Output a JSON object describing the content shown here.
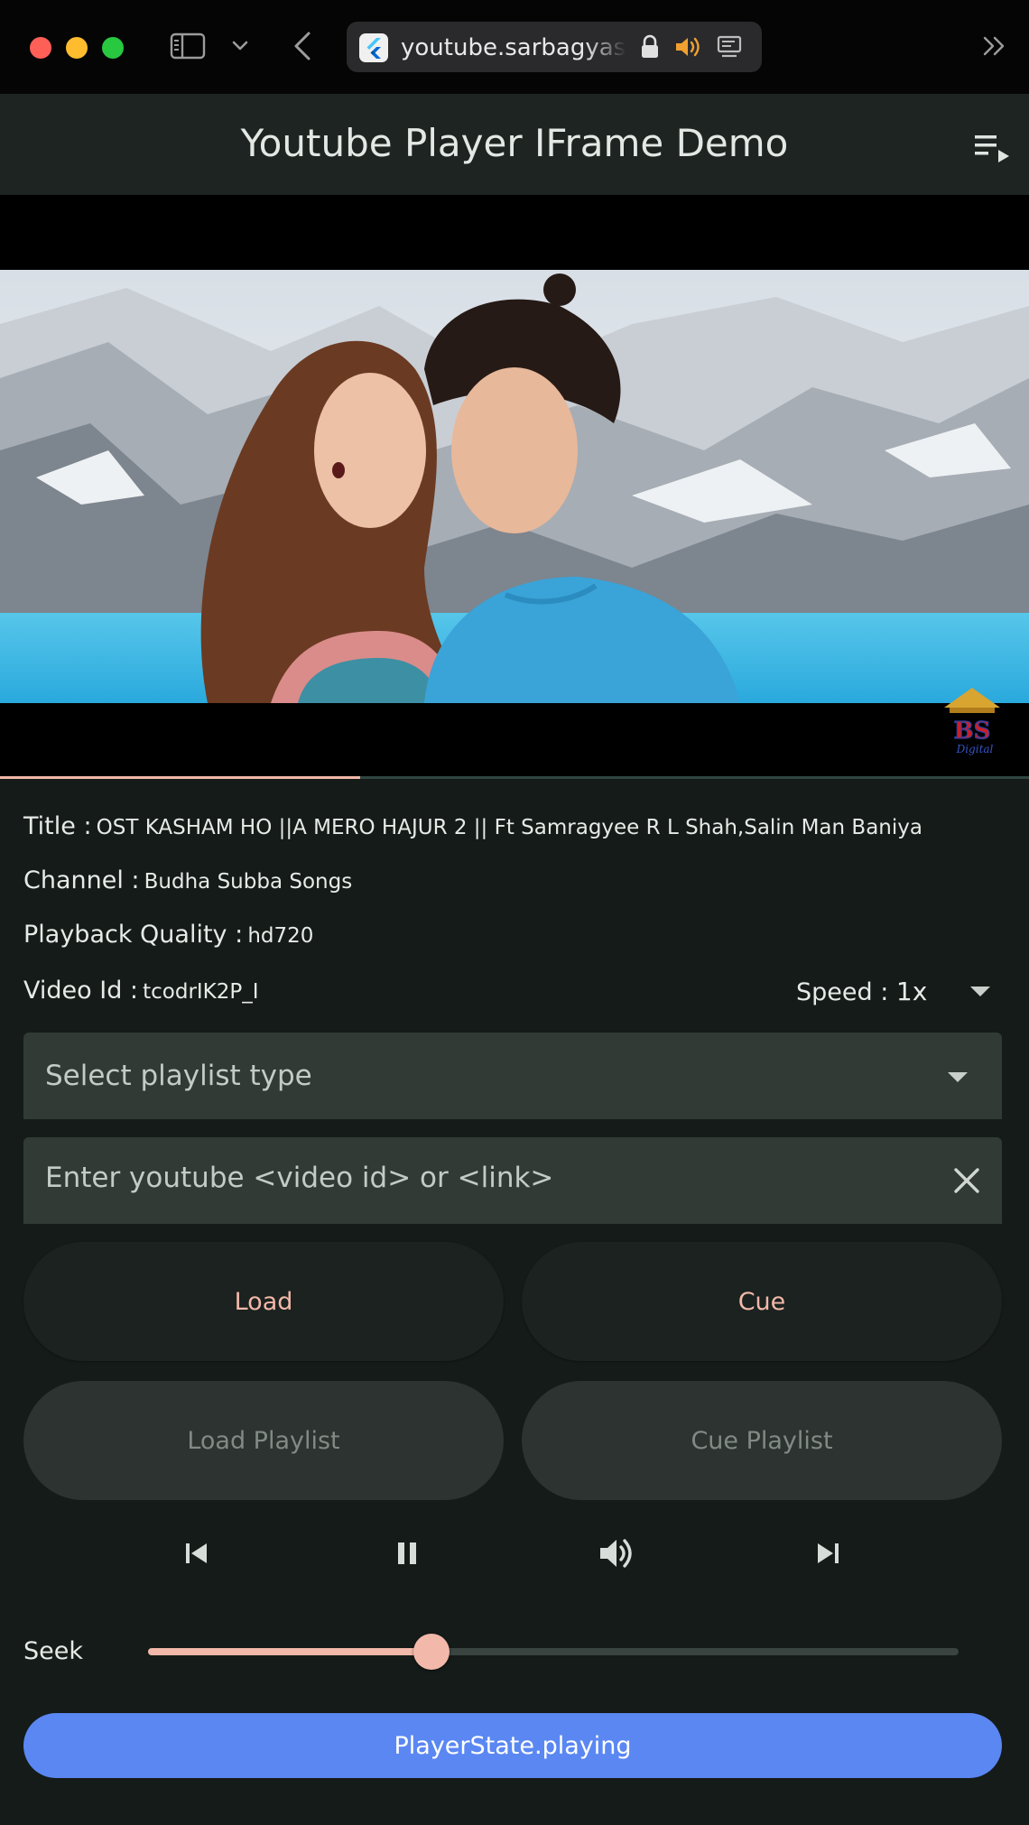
{
  "browser": {
    "url": "youtube.sarbagyasth",
    "icons": [
      "sidebar-icon",
      "chevron-down-icon",
      "back-arrow-icon",
      "flutter-favicon",
      "lock-icon",
      "speaker-icon",
      "picture-in-picture-icon",
      "double-chevron-right-icon"
    ],
    "traffic_colors": [
      "#fe5f57",
      "#febc2e",
      "#28c840"
    ],
    "speaker_color": "#f0a030"
  },
  "app": {
    "title": "Youtube Player IFrame Demo",
    "queue_icon": "playlist-play-icon"
  },
  "player": {
    "progress_fraction": 0.35
  },
  "info": {
    "title_label": "Title :",
    "title_value": "OST KASHAM HO ||A MERO HAJUR 2 ||  Ft  Samragyee R L Shah,Salin Man Baniya",
    "channel_label": "Channel :",
    "channel_value": "Budha Subba Songs",
    "quality_label": "Playback Quality :",
    "quality_value": "hd720",
    "video_id_label": "Video Id :",
    "video_id_value": "tcodrIK2P_I",
    "speed_label": "Speed :",
    "speed_value": "1x"
  },
  "playlist_select": {
    "placeholder": "Select playlist type"
  },
  "video_input": {
    "placeholder": "Enter youtube <video id> or <link>",
    "value": ""
  },
  "buttons": {
    "load": "Load",
    "cue": "Cue",
    "load_playlist": "Load Playlist",
    "cue_playlist": "Cue Playlist"
  },
  "controls": [
    "skip-previous-icon",
    "pause-icon",
    "volume-up-icon",
    "skip-next-icon"
  ],
  "seek": {
    "label": "Seek",
    "value_fraction": 0.35
  },
  "state": {
    "label": "PlayerState.playing"
  },
  "colors": {
    "accent": "#f2b8a9",
    "state_button": "#5a87f2",
    "background": "#151b19",
    "field": "#323a36"
  }
}
